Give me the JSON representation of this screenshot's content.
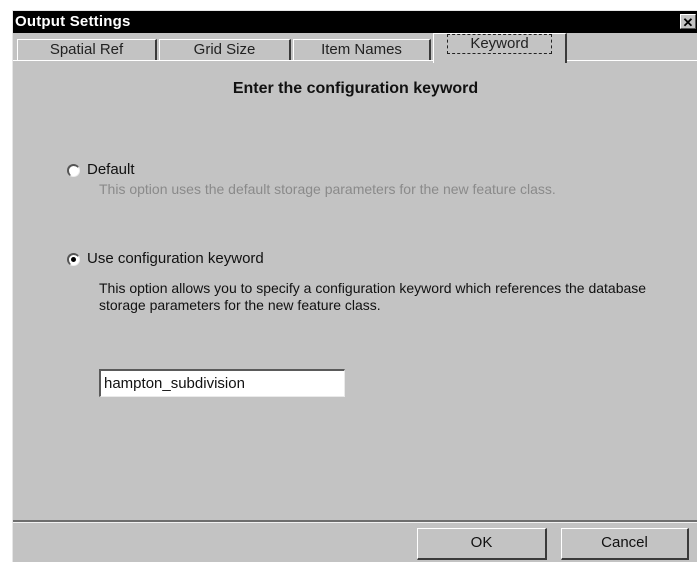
{
  "window": {
    "title": "Output Settings",
    "close_glyph": "✕"
  },
  "tabs": [
    {
      "label": "Spatial Ref",
      "active": false
    },
    {
      "label": "Grid Size",
      "active": false
    },
    {
      "label": "Item Names",
      "active": false
    },
    {
      "label": "Keyword",
      "active": true
    }
  ],
  "panel": {
    "heading": "Enter the configuration keyword",
    "default_option": {
      "label": "Default",
      "description": "This option uses the default storage parameters for the new feature class.",
      "selected": false
    },
    "keyword_option": {
      "label": "Use configuration keyword",
      "description": "This option allows you to specify a configuration keyword which references the database storage parameters for the new feature class.",
      "selected": true
    },
    "keyword_value": "hampton_subdivision"
  },
  "buttons": {
    "ok": "OK",
    "cancel": "Cancel"
  }
}
